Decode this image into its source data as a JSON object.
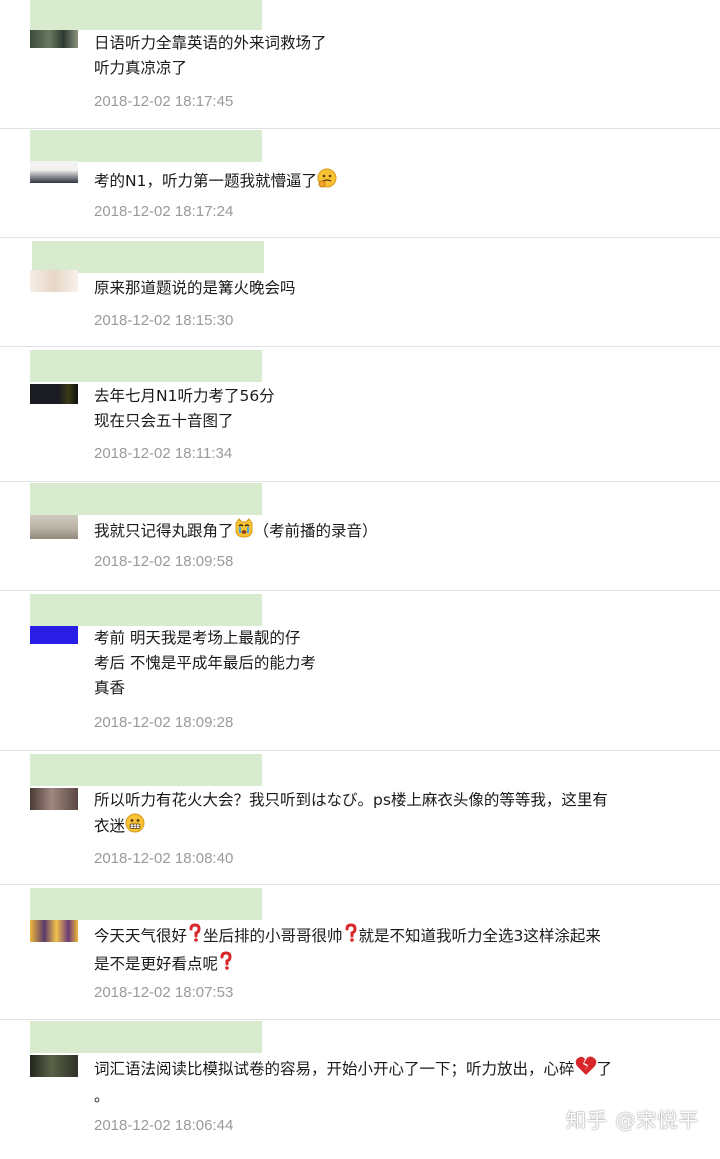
{
  "comments": [
    {
      "lines": [
        "日语听力全靠英语的外来词救场了",
        "听力真凉凉了"
      ],
      "time": "2018-12-02 18:17:45"
    },
    {
      "lines": [
        "考的N1，听力第一题我就懵逼了"
      ],
      "emoji": "thinking-face-icon",
      "time": "2018-12-02 18:17:24"
    },
    {
      "lines": [
        "原来那道题说的是篝火晚会吗"
      ],
      "time": "2018-12-02 18:15:30"
    },
    {
      "lines": [
        "去年七月N1听力考了56分",
        "现在只会五十音图了"
      ],
      "time": "2018-12-02 18:11:34"
    },
    {
      "lines": [
        "我就只记得丸跟角了",
        "（考前播的录音）"
      ],
      "emoji": "crying-cat-face-icon",
      "time": "2018-12-02 18:09:58"
    },
    {
      "lines": [
        "考前 明天我是考场上最靓的仔",
        "考后 不愧是平成年最后的能力考",
        "真香"
      ],
      "time": "2018-12-02 18:09:28"
    },
    {
      "lines": [
        "所以听力有花火大会？我只听到はなび。ps楼上麻衣头像的等等我，这里有",
        "衣迷"
      ],
      "emoji": "grimacing-face-icon",
      "time": "2018-12-02 18:08:40"
    },
    {
      "lines": [
        "今天天气很好",
        "坐后排的小哥哥很帅",
        "就是不知道我听力全选3这样涂起来",
        "是不是更好看点呢"
      ],
      "emoji": "question-mark-icon",
      "time": "2018-12-02 18:07:53"
    },
    {
      "lines": [
        "词汇语法阅读比模拟试卷的容易，开始小开心了一下；听力放出，心碎",
        "了",
        "。"
      ],
      "emoji": "broken-heart-icon",
      "time": "2018-12-02 18:06:44"
    }
  ],
  "watermark": "知乎 @宋悦平",
  "colors": {
    "namebar": "#d9ebcf",
    "text": "#1a1a1a",
    "time": "#9a9a9a",
    "divider": "#e2e2e2"
  }
}
